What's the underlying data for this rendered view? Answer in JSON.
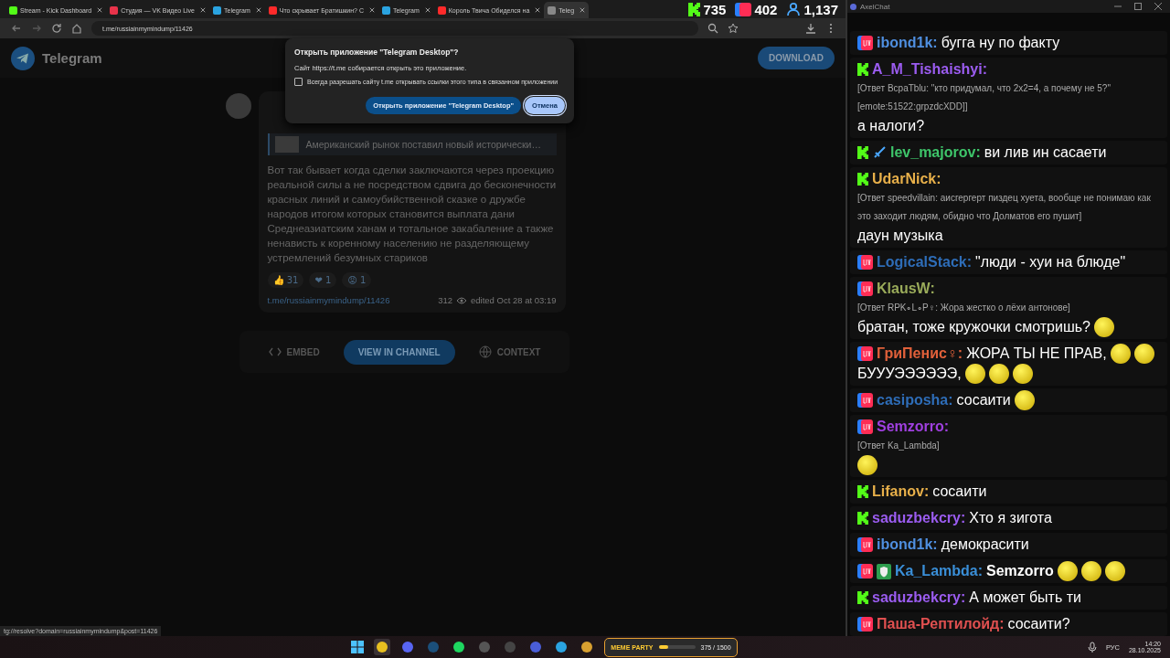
{
  "browser": {
    "tabs": [
      {
        "title": "Stream - Kick Dashboard",
        "kind": "kick",
        "selected": false
      },
      {
        "title": "Студия — VK Видео Live",
        "kind": "vk",
        "selected": false
      },
      {
        "title": "Telegram",
        "kind": "telegram",
        "selected": false
      },
      {
        "title": "Что скрывает Братишкин? С",
        "kind": "youtube",
        "selected": false
      },
      {
        "title": "Telegram",
        "kind": "telegram",
        "selected": false
      },
      {
        "title": "Король Твича Обиделся на",
        "kind": "youtube",
        "selected": false
      },
      {
        "title": "Teleg",
        "kind": "web",
        "selected": true
      }
    ],
    "url": "t.me/russiainmymindump/11426",
    "status_url": "tg://resolve?domain=russiainmymindump&post=11426"
  },
  "stream_counters": [
    {
      "kind": "kick",
      "value": "735"
    },
    {
      "kind": "vk",
      "value": "402"
    },
    {
      "kind": "viewers",
      "value": "1,137"
    }
  ],
  "telegram": {
    "brand": "Telegram",
    "download": "DOWNLOAD",
    "post": {
      "reply_preview": "Американский рынок поставил новый исторически…",
      "text": "Вот так бывает когда сделки заключаются через проекцию реальной силы а не посредством сдвига до бесконечности красных линий и самоубийственной сказке о дружбе народов итогом которых становится выплата дани Среднеазиатским ханам и тотальное закабаление а также ненависть к коренному населению не разделяющему устремлений безумных стариков",
      "reactions": [
        {
          "emoji": "👍",
          "count": "31"
        },
        {
          "emoji": "❤",
          "count": "1"
        },
        {
          "emoji": "😡",
          "count": "1"
        }
      ],
      "link": "t.me/russiainmymindump/11426",
      "views": "312",
      "edited": "edited  Oct 28 at 03:19"
    },
    "actions": [
      {
        "label": "EMBED",
        "kind": "code"
      },
      {
        "label": "VIEW IN CHANNEL",
        "kind": "primary"
      },
      {
        "label": "CONTEXT",
        "kind": "globe"
      }
    ]
  },
  "dialog": {
    "title": "Открыть приложение \"Telegram Desktop\"?",
    "text": "Сайт https://t.me собирается открыть это приложение.",
    "checkbox": {
      "label": "Всегда разрешать сайту t.me открывать ссылки этого типа в связанном приложении",
      "checked": false
    },
    "buttons": [
      {
        "label": "Открыть приложение \"Telegram Desktop\"",
        "kind": "primary"
      },
      {
        "label": "Отмена",
        "kind": "secondary"
      }
    ]
  },
  "chat": {
    "title": "AxelChat",
    "messages": [
      {
        "kind": "vk",
        "name": "ibond1k:",
        "color": "#4f8fe0",
        "parts": [
          {
            "kind": "text",
            "text": "бугга ну по факту"
          }
        ]
      },
      {
        "kind": "kick",
        "name": "A_M_Tishaishyi:",
        "color": "#9b5cf0",
        "reply": "[Ответ BcpaTblu: \"кто придумал, что 2x2=4, а почему не 5?\" [emote:51522:grpzdcXDD]]",
        "parts": [
          {
            "kind": "text",
            "text": "а налоги?"
          }
        ]
      },
      {
        "kind": "kick",
        "badges": [
          {
            "kind": "sword"
          }
        ],
        "name": "lev_majorov:",
        "color": "#3ec56a",
        "parts": [
          {
            "kind": "text",
            "text": "ви лив ин сасаети"
          }
        ]
      },
      {
        "kind": "kick",
        "name": "UdarNick:",
        "color": "#e8b04a",
        "reply": "[Ответ speedvillain: аисгергерт пиздец хуета, вообще не понимаю как это заходит людям, обидно что Долматов его пушит]",
        "parts": [
          {
            "kind": "text",
            "text": "даун музыка"
          }
        ]
      },
      {
        "kind": "vk",
        "name": "LogicalStack:",
        "color": "#2e6db8",
        "parts": [
          {
            "kind": "text",
            "text": "\"люди - хуи на блюде\""
          }
        ]
      },
      {
        "kind": "vk",
        "name": "KlausW:",
        "color": "#9aab5a",
        "reply": "[Ответ RPK∘L∘P♀: Жора жестко о лёхи антонове]",
        "parts": [
          {
            "kind": "text",
            "text": "братан, тоже кружочки смотришь?"
          },
          {
            "kind": "emote"
          }
        ]
      },
      {
        "kind": "vk",
        "name": "ГриПенис♀:",
        "color": "#e0603a",
        "parts": [
          {
            "kind": "text",
            "text": "ЖОРА ТЫ НЕ ПРАВ,"
          },
          {
            "kind": "emote"
          },
          {
            "kind": "emote"
          },
          {
            "kind": "text",
            "text": "БУУУЭЭЭЭЭЭ,"
          },
          {
            "kind": "emote"
          },
          {
            "kind": "emote"
          },
          {
            "kind": "emote"
          }
        ]
      },
      {
        "kind": "vk",
        "name": "casiposha:",
        "color": "#2e6db8",
        "parts": [
          {
            "kind": "text",
            "text": "сосаити"
          },
          {
            "kind": "emote"
          }
        ]
      },
      {
        "kind": "vk",
        "name": "Semzorro:",
        "color": "#a040e0",
        "reply": "[Ответ Ka_Lambda]",
        "parts": [
          {
            "kind": "emote"
          }
        ]
      },
      {
        "kind": "kick",
        "name": "Lifanov:",
        "color": "#e8b04a",
        "parts": [
          {
            "kind": "text",
            "text": "сосаити"
          }
        ]
      },
      {
        "kind": "kick",
        "name": "saduzbekcry:",
        "color": "#9b5cf0",
        "parts": [
          {
            "kind": "text",
            "text": "Хто я зигота"
          }
        ]
      },
      {
        "kind": "vk",
        "name": "ibond1k:",
        "color": "#4f8fe0",
        "parts": [
          {
            "kind": "text",
            "text": "демокрасити"
          }
        ]
      },
      {
        "kind": "vk",
        "badges": [
          {
            "kind": "shield"
          }
        ],
        "name": "Ka_Lambda:",
        "color": "#3a8fd8",
        "parts": [
          {
            "kind": "mention",
            "text": "Semzorro"
          },
          {
            "kind": "emote"
          },
          {
            "kind": "emote"
          },
          {
            "kind": "emote"
          }
        ]
      },
      {
        "kind": "kick",
        "name": "saduzbekcry:",
        "color": "#9b5cf0",
        "parts": [
          {
            "kind": "text",
            "text": "А может быть ти"
          }
        ]
      },
      {
        "kind": "vk",
        "name": "Паша-Рептилойд:",
        "color": "#e05050",
        "parts": [
          {
            "kind": "text",
            "text": "сосаити?"
          }
        ]
      }
    ]
  },
  "taskbar": {
    "apps": [
      {
        "kind": "start",
        "selected": false
      },
      {
        "kind": "chrome",
        "selected": true
      },
      {
        "kind": "discord",
        "selected": false
      },
      {
        "kind": "steam",
        "selected": false
      },
      {
        "kind": "spotify",
        "selected": false
      },
      {
        "kind": "obs",
        "selected": false
      },
      {
        "kind": "window",
        "selected": false
      },
      {
        "kind": "play",
        "selected": false
      },
      {
        "kind": "telegram",
        "selected": false
      },
      {
        "kind": "files",
        "selected": false
      }
    ],
    "widget": {
      "label": "MEME PARTY",
      "progress": "375 / 1500",
      "level": 0.25
    },
    "language": "РУС",
    "time": "14:20",
    "date": "28.10.2025"
  }
}
